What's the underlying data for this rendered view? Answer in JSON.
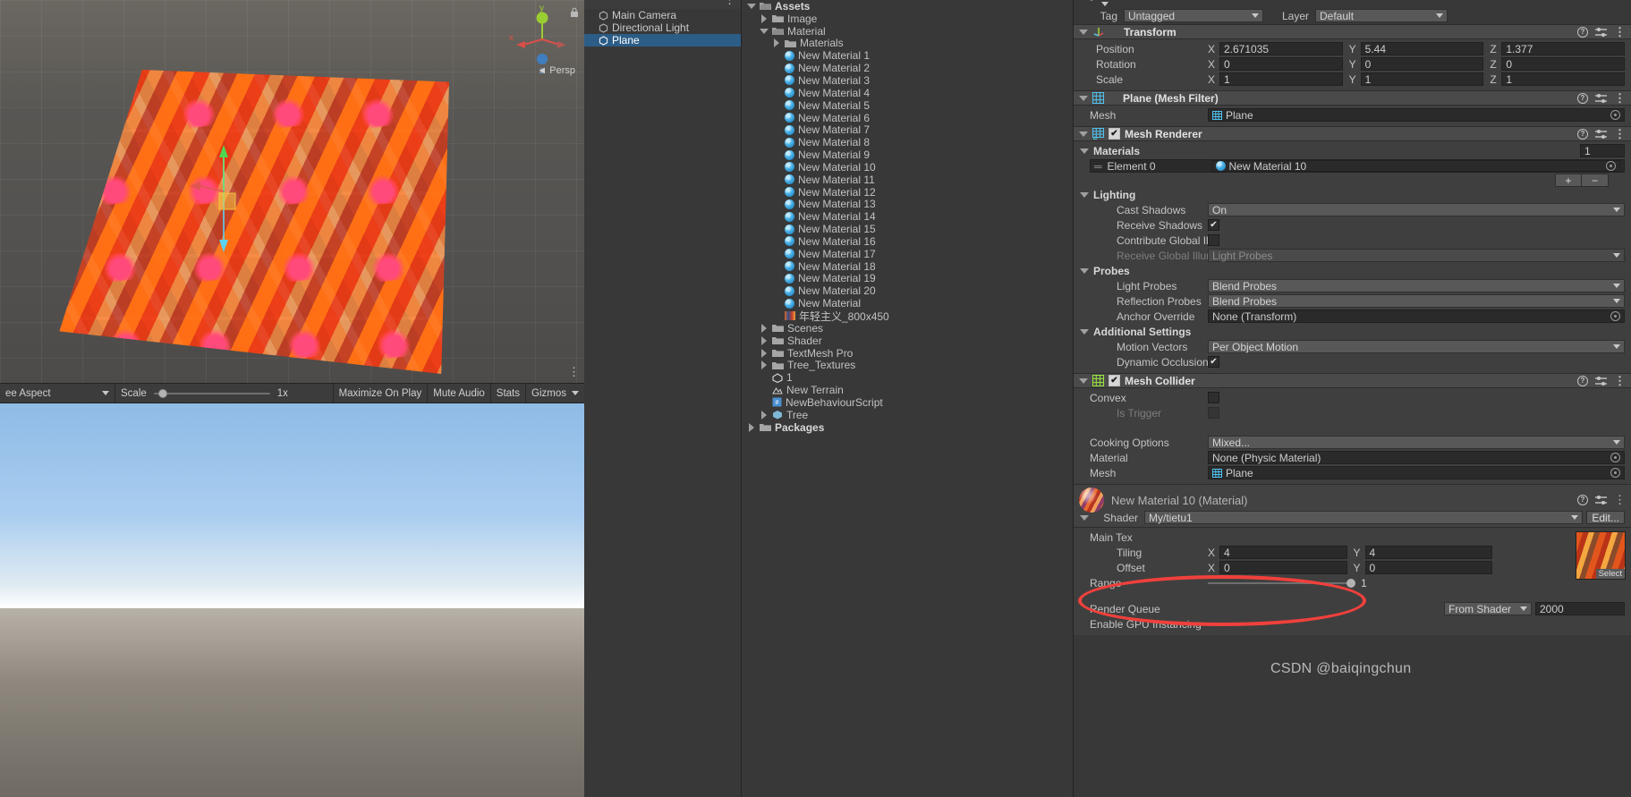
{
  "scene_view": {
    "gizmo": {
      "x_label": "x",
      "y_label": "y",
      "z_label": "z",
      "persp_label": "Persp"
    }
  },
  "game_toolbar": {
    "aspect": "ee Aspect",
    "scale_label": "Scale",
    "scale_value": "1x",
    "maximize_on_play": "Maximize On Play",
    "mute_audio": "Mute Audio",
    "stats": "Stats",
    "gizmos": "Gizmos"
  },
  "hierarchy": {
    "items": [
      {
        "label": "Main Camera",
        "selected": false
      },
      {
        "label": "Directional Light",
        "selected": false
      },
      {
        "label": "Plane",
        "selected": true
      }
    ]
  },
  "project": {
    "rows": [
      {
        "label": "Assets",
        "indent": 0,
        "arrow": "down",
        "icon": "folder-open",
        "bold": true
      },
      {
        "label": "Image",
        "indent": 1,
        "arrow": "right",
        "icon": "folder",
        "bold": false
      },
      {
        "label": "Material",
        "indent": 1,
        "arrow": "down",
        "icon": "folder-open",
        "bold": false
      },
      {
        "label": "Materials",
        "indent": 2,
        "arrow": "right",
        "icon": "folder",
        "bold": false
      },
      {
        "label": "New Material 1",
        "indent": 2,
        "arrow": "none",
        "icon": "material",
        "bold": false
      },
      {
        "label": "New Material 2",
        "indent": 2,
        "arrow": "none",
        "icon": "material",
        "bold": false
      },
      {
        "label": "New Material 3",
        "indent": 2,
        "arrow": "none",
        "icon": "material",
        "bold": false
      },
      {
        "label": "New Material 4",
        "indent": 2,
        "arrow": "none",
        "icon": "material",
        "bold": false
      },
      {
        "label": "New Material 5",
        "indent": 2,
        "arrow": "none",
        "icon": "material",
        "bold": false
      },
      {
        "label": "New Material 6",
        "indent": 2,
        "arrow": "none",
        "icon": "material",
        "bold": false
      },
      {
        "label": "New Material 7",
        "indent": 2,
        "arrow": "none",
        "icon": "material",
        "bold": false
      },
      {
        "label": "New Material 8",
        "indent": 2,
        "arrow": "none",
        "icon": "material",
        "bold": false
      },
      {
        "label": "New Material 9",
        "indent": 2,
        "arrow": "none",
        "icon": "material",
        "bold": false
      },
      {
        "label": "New Material 10",
        "indent": 2,
        "arrow": "none",
        "icon": "material",
        "bold": false
      },
      {
        "label": "New Material 11",
        "indent": 2,
        "arrow": "none",
        "icon": "material",
        "bold": false
      },
      {
        "label": "New Material 12",
        "indent": 2,
        "arrow": "none",
        "icon": "material",
        "bold": false
      },
      {
        "label": "New Material 13",
        "indent": 2,
        "arrow": "none",
        "icon": "material",
        "bold": false
      },
      {
        "label": "New Material 14",
        "indent": 2,
        "arrow": "none",
        "icon": "material",
        "bold": false
      },
      {
        "label": "New Material 15",
        "indent": 2,
        "arrow": "none",
        "icon": "material",
        "bold": false
      },
      {
        "label": "New Material 16",
        "indent": 2,
        "arrow": "none",
        "icon": "material",
        "bold": false
      },
      {
        "label": "New Material 17",
        "indent": 2,
        "arrow": "none",
        "icon": "material",
        "bold": false
      },
      {
        "label": "New Material 18",
        "indent": 2,
        "arrow": "none",
        "icon": "material",
        "bold": false
      },
      {
        "label": "New Material 19",
        "indent": 2,
        "arrow": "none",
        "icon": "material",
        "bold": false
      },
      {
        "label": "New Material 20",
        "indent": 2,
        "arrow": "none",
        "icon": "material",
        "bold": false
      },
      {
        "label": "New Material",
        "indent": 2,
        "arrow": "none",
        "icon": "material",
        "bold": false
      },
      {
        "label": "年轻主义_800x450",
        "indent": 2,
        "arrow": "none",
        "icon": "texture",
        "bold": false
      },
      {
        "label": "Scenes",
        "indent": 1,
        "arrow": "right",
        "icon": "folder",
        "bold": false
      },
      {
        "label": "Shader",
        "indent": 1,
        "arrow": "right",
        "icon": "folder",
        "bold": false
      },
      {
        "label": "TextMesh Pro",
        "indent": 1,
        "arrow": "right",
        "icon": "folder",
        "bold": false
      },
      {
        "label": "Tree_Textures",
        "indent": 1,
        "arrow": "right",
        "icon": "folder",
        "bold": false
      },
      {
        "label": "1",
        "indent": 1,
        "arrow": "none",
        "icon": "unity",
        "bold": false
      },
      {
        "label": "New Terrain",
        "indent": 1,
        "arrow": "none",
        "icon": "terrain",
        "bold": false
      },
      {
        "label": "NewBehaviourScript",
        "indent": 1,
        "arrow": "none",
        "icon": "script",
        "bold": false
      },
      {
        "label": "Tree",
        "indent": 1,
        "arrow": "right",
        "icon": "prefab",
        "bold": false
      },
      {
        "label": "Packages",
        "indent": 0,
        "arrow": "right",
        "icon": "folder",
        "bold": true
      }
    ]
  },
  "inspector": {
    "tag_label": "Tag",
    "tag_value": "Untagged",
    "layer_label": "Layer",
    "layer_value": "Default",
    "transform": {
      "title": "Transform",
      "position_label": "Position",
      "position": {
        "x": "2.671035",
        "y": "5.44",
        "z": "1.377"
      },
      "rotation_label": "Rotation",
      "rotation": {
        "x": "0",
        "y": "0",
        "z": "0"
      },
      "scale_label": "Scale",
      "scale": {
        "x": "1",
        "y": "1",
        "z": "1"
      },
      "axis": {
        "x": "X",
        "y": "Y",
        "z": "Z"
      }
    },
    "mesh_filter": {
      "title": "Plane (Mesh Filter)",
      "mesh_label": "Mesh",
      "mesh_value": "Plane"
    },
    "mesh_renderer": {
      "title": "Mesh Renderer",
      "enabled": true,
      "materials_label": "Materials",
      "materials_count": "1",
      "element_label": "Element 0",
      "element_value": "New Material 10",
      "add_label": "+",
      "remove_label": "−",
      "lighting_label": "Lighting",
      "cast_shadows_label": "Cast Shadows",
      "cast_shadows_value": "On",
      "receive_shadows_label": "Receive Shadows",
      "receive_shadows_checked": true,
      "contribute_gi_label": "Contribute Global Illumin",
      "contribute_gi_checked": false,
      "receive_gi_label": "Receive Global Illuminati",
      "receive_gi_value": "Light Probes",
      "probes_label": "Probes",
      "light_probes_label": "Light Probes",
      "light_probes_value": "Blend Probes",
      "reflection_probes_label": "Reflection Probes",
      "reflection_probes_value": "Blend Probes",
      "anchor_override_label": "Anchor Override",
      "anchor_override_value": "None (Transform)",
      "additional_settings_label": "Additional Settings",
      "motion_vectors_label": "Motion Vectors",
      "motion_vectors_value": "Per Object Motion",
      "dynamic_occlusion_label": "Dynamic Occlusion",
      "dynamic_occlusion_checked": true
    },
    "mesh_collider": {
      "title": "Mesh Collider",
      "enabled": true,
      "convex_label": "Convex",
      "convex_checked": false,
      "is_trigger_label": "Is Trigger",
      "is_trigger_checked": false,
      "cooking_options_label": "Cooking Options",
      "cooking_options_value": "Mixed...",
      "material_label": "Material",
      "material_value": "None (Physic Material)",
      "mesh_label": "Mesh",
      "mesh_value": "Plane"
    },
    "material": {
      "title": "New Material 10 (Material)",
      "shader_label": "Shader",
      "shader_value": "My/tietu1",
      "edit_label": "Edit...",
      "main_tex_label": "Main Tex",
      "select_label": "Select",
      "tiling_label": "Tiling",
      "tiling": {
        "x": "4",
        "y": "4"
      },
      "offset_label": "Offset",
      "offset": {
        "x": "0",
        "y": "0"
      },
      "axis": {
        "x": "X",
        "y": "Y"
      },
      "range_label": "Range",
      "range_value": "1",
      "render_queue_label": "Render Queue",
      "render_queue_mode": "From Shader",
      "render_queue_value": "2000",
      "gpu_instancing_label": "Enable GPU Instancing"
    }
  },
  "annotation": {
    "watermark": "CSDN @baiqingchun",
    "highlight_color": "#f0403c"
  }
}
